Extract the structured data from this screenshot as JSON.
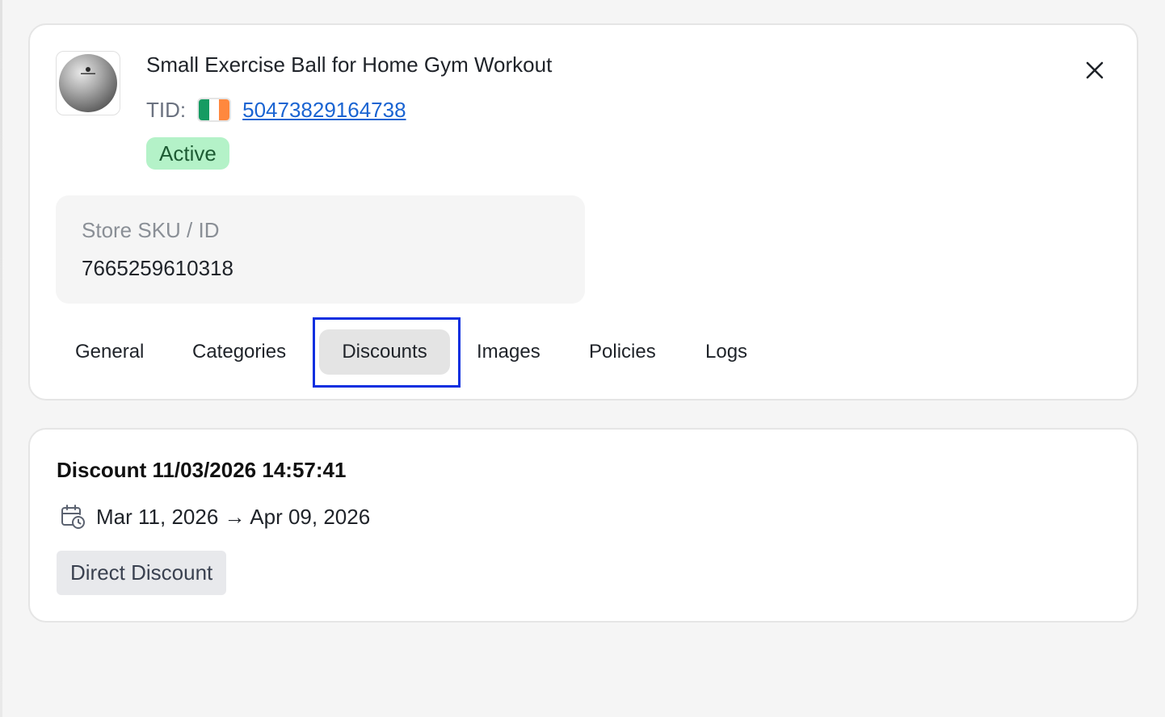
{
  "product": {
    "title": "Small Exercise Ball for Home Gym Workout",
    "tid_label": "TID:",
    "tid_value": "50473829164738",
    "flag_icon": "ireland-flag-icon",
    "flag_colors": [
      "#169b62",
      "#ffffff",
      "#ff883e"
    ],
    "status": "Active",
    "sku_label": "Store SKU / ID",
    "sku_value": "7665259610318"
  },
  "tabs": [
    {
      "label": "General",
      "selected": false
    },
    {
      "label": "Categories",
      "selected": false
    },
    {
      "label": "Discounts",
      "selected": true
    },
    {
      "label": "Images",
      "selected": false
    },
    {
      "label": "Policies",
      "selected": false
    },
    {
      "label": "Logs",
      "selected": false
    }
  ],
  "discount": {
    "title": "Discount 11/03/2026 14:57:41",
    "date_range": "Mar 11, 2026 → Apr 09, 2026",
    "date_icon": "calendar-clock-icon",
    "type": "Direct Discount"
  },
  "colors": {
    "link": "#1a64d2",
    "status_bg": "#b4f2c8",
    "status_text": "#1d5b33",
    "focus_ring": "#0c2fe0",
    "selected_tab_bg": "#e4e4e4"
  }
}
